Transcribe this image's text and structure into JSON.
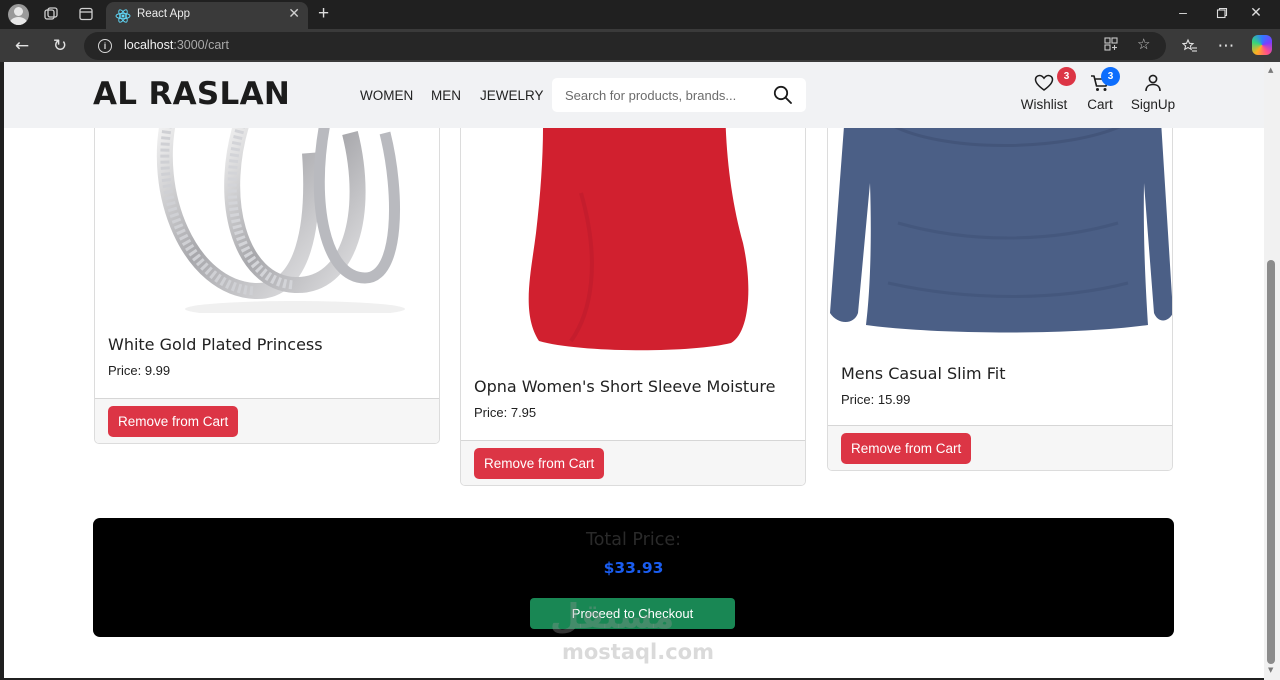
{
  "browser": {
    "tab_title": "React App",
    "url_host": "localhost",
    "url_path": ":3000/cart"
  },
  "navbar": {
    "brand": "AL RASLAN",
    "links": [
      "WOMEN",
      "MEN",
      "JEWELRY"
    ],
    "search_placeholder": "Search for products, brands...",
    "wishlist": {
      "label": "Wishlist",
      "count": "3",
      "badge_color": "#dc3545"
    },
    "cart": {
      "label": "Cart",
      "count": "3",
      "badge_color": "#0d6efd"
    },
    "signup": {
      "label": "SignUp"
    }
  },
  "cart_items": [
    {
      "title": "White Gold Plated Princess",
      "price": "Price: 9.99",
      "remove_label": "Remove from Cart",
      "image": "silver-rings"
    },
    {
      "title": "Opna Women's Short Sleeve Moisture",
      "price": "Price: 7.95",
      "remove_label": "Remove from Cart",
      "image": "red-shirt"
    },
    {
      "title": "Mens Casual Slim Fit",
      "price": "Price: 15.99",
      "remove_label": "Remove from Cart",
      "image": "blue-long-sleeve-shirt"
    }
  ],
  "total": {
    "label": "Total Price:",
    "value": "$33.93",
    "checkout_label": "Proceed to Checkout"
  },
  "watermark": {
    "arabic": "مستقل",
    "latin": "mostaql.com"
  },
  "colors": {
    "danger": "#dc3545",
    "success": "#198754",
    "primary": "#0d6efd"
  }
}
